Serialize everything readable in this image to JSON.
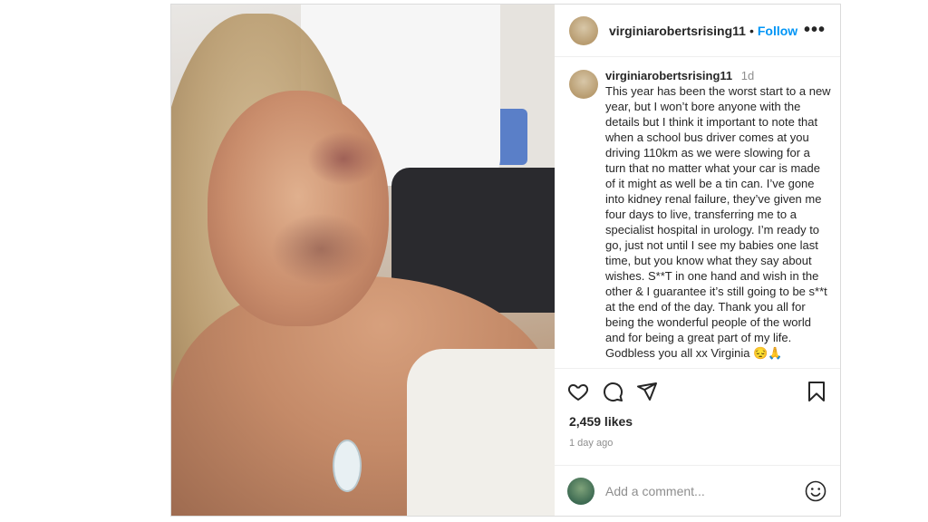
{
  "post": {
    "username": "virginiarobertsrising11",
    "separator": "•",
    "follow_label": "Follow",
    "more_label": "•••",
    "caption": {
      "username": "virginiarobertsrising11",
      "time": "1d",
      "text": "This year has been the worst start to a new year, but I won’t bore anyone with the details but I think it important to note that when a school bus driver comes at you driving 110km as we were slowing for a turn that no matter what your car is made of it might as well be a tin can. I’ve gone into kidney renal failure, they’ve given me four days to live, transferring me to a specialist hospital in urology. I’m ready to go, just not until I see my babies one last time, but you know what they say about wishes. S**T in one hand and wish in the other & I guarantee it’s still going to be s**t at the end of the day. Thank you all for being the wonderful people of the world and for being a great part of my life. Godbless you all xx Virginia 😔🙏"
    },
    "likes": "2,459 likes",
    "posted_ago": "1 day ago",
    "comment_placeholder": "Add a comment...",
    "icons": {
      "like": "heart-icon",
      "comment": "comment-icon",
      "share": "share-icon",
      "save": "bookmark-icon",
      "emoji": "emoji-icon"
    },
    "colors": {
      "follow": "#0095f6",
      "muted": "#8e8e8e",
      "text": "#262626"
    }
  }
}
